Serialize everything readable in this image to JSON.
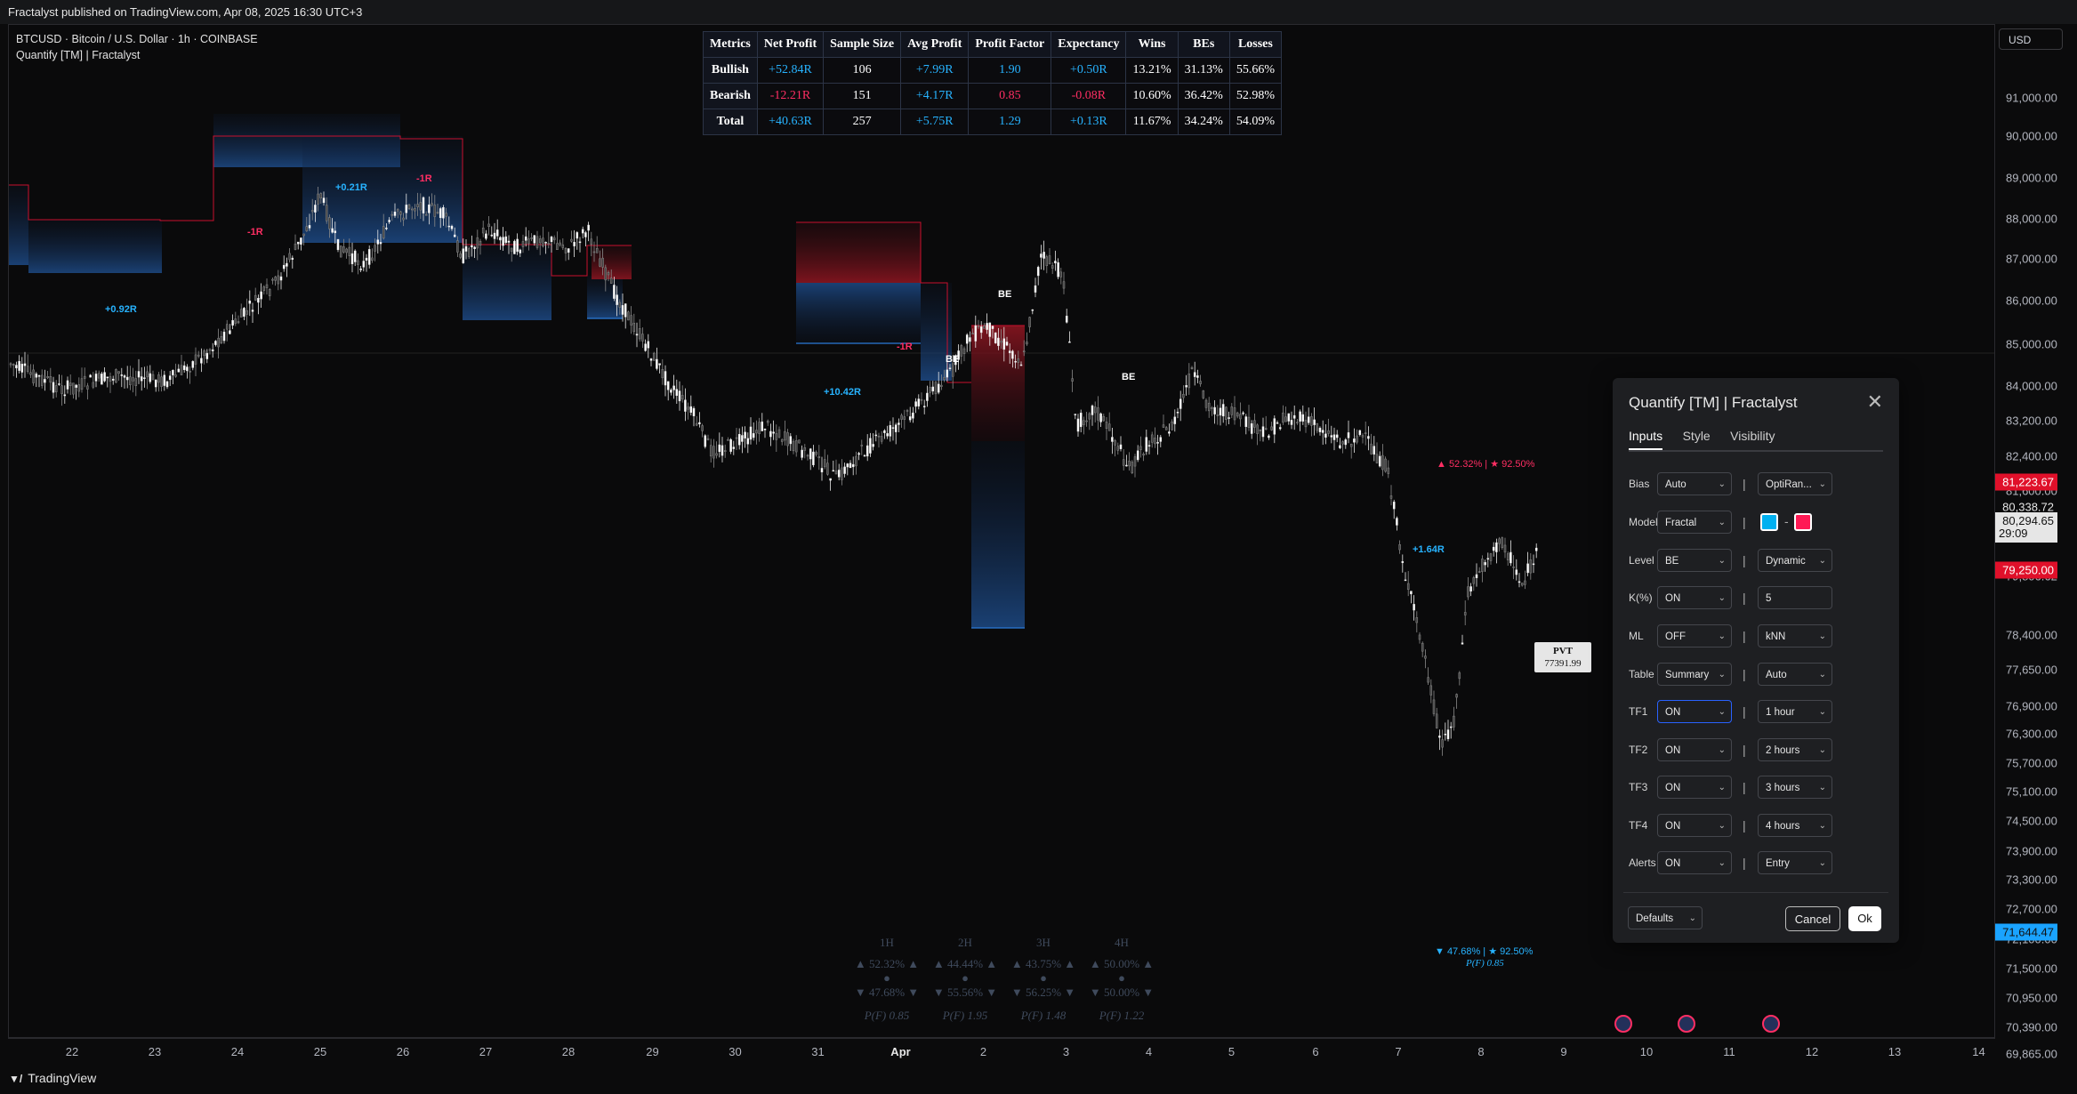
{
  "topbar": {
    "text": "Fractalyst published on TradingView.com, Apr 08, 2025 16:30 UTC+3"
  },
  "chart": {
    "symbol_line": "BTCUSD · Bitcoin / U.S. Dollar · 1h · COINBASE",
    "indicator_line": "Quantify [TM] | Fractalyst"
  },
  "metrics_table": {
    "headers": [
      "Metrics",
      "Net Profit",
      "Sample Size",
      "Avg Profit",
      "Profit Factor",
      "Expectancy",
      "Wins",
      "BEs",
      "Losses"
    ],
    "rows": [
      {
        "label": "Bullish",
        "net": "+52.84R",
        "size": "106",
        "avg": "+7.99R",
        "pf": "1.90",
        "exp": "+0.50R",
        "wins": "13.21%",
        "bes": "31.13%",
        "losses": "55.66%"
      },
      {
        "label": "Bearish",
        "net": "-12.21R",
        "size": "151",
        "avg": "+4.17R",
        "pf": "0.85",
        "exp": "-0.08R",
        "wins": "10.60%",
        "bes": "36.42%",
        "losses": "52.98%"
      },
      {
        "label": "Total",
        "net": "+40.63R",
        "size": "257",
        "avg": "+5.75R",
        "pf": "1.29",
        "exp": "+0.13R",
        "wins": "11.67%",
        "bes": "34.24%",
        "losses": "54.09%"
      }
    ]
  },
  "annotations": {
    "a1": "+0.92R",
    "a2": "-1R",
    "a3": "+0.21R",
    "a4": "-1R",
    "a5": "+10.42R",
    "a6": "-1R",
    "a7": "BE",
    "a8": "BE",
    "a9": "BE",
    "a10": "+1.64R",
    "top_stats": "▲ 52.32% | ★ 92.50%",
    "bottom_stats": "▼ 47.68% | ★ 92.50%",
    "bottom_pf": "P(F) 0.85"
  },
  "pvt": {
    "label": "PVT",
    "value": "77391.99"
  },
  "mtf_table": {
    "cols": [
      {
        "tf": "1H",
        "up": "▲ 52.32% ▲",
        "down": "▼ 47.68% ▼",
        "pf": "P(F) 0.85"
      },
      {
        "tf": "2H",
        "up": "▲ 44.44% ▲",
        "down": "▼ 55.56% ▼",
        "pf": "P(F) 1.95"
      },
      {
        "tf": "3H",
        "up": "▲ 43.75% ▲",
        "down": "▼ 56.25% ▼",
        "pf": "P(F) 1.48"
      },
      {
        "tf": "4H",
        "up": "▲ 50.00% ▲",
        "down": "▼ 50.00% ▼",
        "pf": "P(F) 1.22"
      }
    ]
  },
  "yaxis": {
    "currency": "USD",
    "labels": [
      "91,000.00",
      "90,000.00",
      "89,000.00",
      "88,000.00",
      "87,000.00",
      "86,000.00",
      "85,000.00",
      "84,000.00",
      "83,200.00",
      "82,400.00",
      "81,600.00",
      "80,800.00",
      "79,806.62",
      "78,400.00",
      "77,650.00",
      "76,900.00",
      "76,300.00",
      "75,700.00",
      "75,100.00",
      "74,500.00",
      "73,900.00",
      "73,300.00",
      "72,700.00",
      "72,100.00",
      "71,500.00",
      "70,950.00",
      "70,390.00",
      "69,865.00"
    ],
    "tag_red_top": "81,223.67",
    "tag_last": "80,338.72",
    "tag_current": "80,294.65",
    "tag_countdown": "29:09",
    "tag_red_bottom": "79,250.00",
    "tag_blue": "71,644.47"
  },
  "xaxis": {
    "labels": [
      "22",
      "23",
      "24",
      "25",
      "26",
      "27",
      "28",
      "29",
      "30",
      "31",
      "Apr",
      "2",
      "3",
      "4",
      "5",
      "6",
      "7",
      "8",
      "9",
      "10",
      "11",
      "12",
      "13",
      "14"
    ]
  },
  "dialog": {
    "title": "Quantify [TM] | Fractalyst",
    "tabs": [
      "Inputs",
      "Style",
      "Visibility"
    ],
    "rows": [
      {
        "label": "Bias",
        "a": "Auto",
        "b": "OptiRan..."
      },
      {
        "label": "Model",
        "a": "Fractal"
      },
      {
        "label": "Level",
        "a": "BE",
        "b": "Dynamic"
      },
      {
        "label": "K(%)",
        "a": "ON",
        "b": "5"
      },
      {
        "label": "ML",
        "a": "OFF",
        "b": "kNN"
      },
      {
        "label": "Table",
        "a": "Summary",
        "b": "Auto"
      },
      {
        "label": "TF1",
        "a": "ON",
        "b": "1 hour"
      },
      {
        "label": "TF2",
        "a": "ON",
        "b": "2 hours"
      },
      {
        "label": "TF3",
        "a": "ON",
        "b": "3 hours"
      },
      {
        "label": "TF4",
        "a": "ON",
        "b": "4 hours"
      },
      {
        "label": "Alerts",
        "a": "ON",
        "b": "Entry"
      }
    ],
    "defaults": "Defaults",
    "cancel": "Cancel",
    "ok": "Ok",
    "bull_color": "#00b0f0",
    "bear_color": "#ff1a55"
  },
  "footer": {
    "brand": "TradingView"
  }
}
